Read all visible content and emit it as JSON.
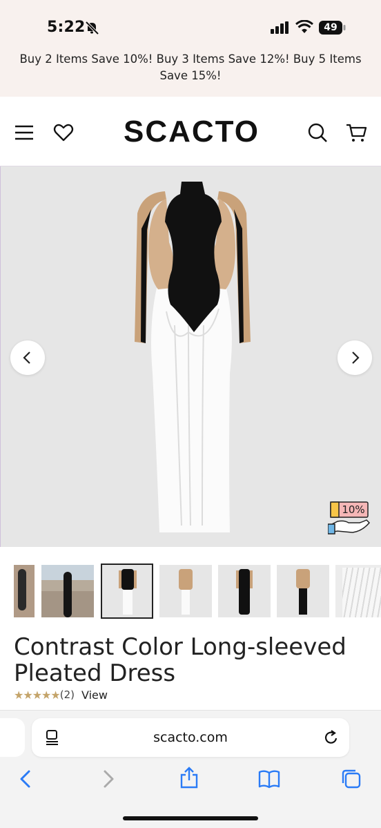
{
  "status_bar": {
    "time": "5:22",
    "battery": "49"
  },
  "promo": {
    "text": "Buy 2 Items Save 10%! Buy 3 Items Save 12%! Buy 5 Items Save 15%!"
  },
  "header": {
    "logo": "SCACTO"
  },
  "gallery": {
    "discount_badge": "10%"
  },
  "product": {
    "title": "Contrast Color Long-sleeved Pleated Dress",
    "stars": "★★★★★",
    "review_count": "(2)",
    "view_label": "View"
  },
  "browser": {
    "url": "scacto.com"
  }
}
